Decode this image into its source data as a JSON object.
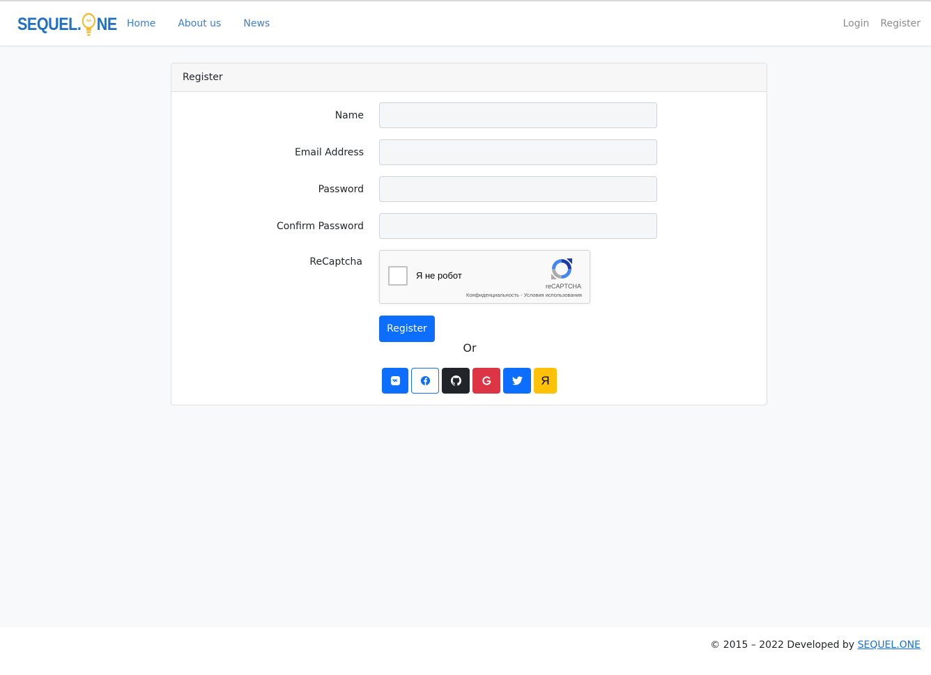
{
  "navbar": {
    "logo": {
      "part1": "SEQUEL.",
      "part2": "NE"
    },
    "links": [
      "Home",
      "About us",
      "News"
    ],
    "auth": {
      "login": "Login",
      "register": "Register"
    }
  },
  "card": {
    "header": "Register",
    "fields": [
      {
        "label": "Name",
        "value": ""
      },
      {
        "label": "Email Address",
        "value": ""
      },
      {
        "label": "Password",
        "value": ""
      },
      {
        "label": "Confirm Password",
        "value": ""
      }
    ],
    "captcha": {
      "label": "ReCaptcha",
      "checkbox_text": "Я не робот",
      "brand": "reCAPTCHA",
      "links": "Конфиденциальность - Условия использования"
    },
    "submit_label": "Register",
    "or_text": "Or",
    "socials": [
      {
        "name": "vk",
        "color": "#0d6efd"
      },
      {
        "name": "facebook",
        "color": "#ffffff"
      },
      {
        "name": "github",
        "color": "#212529"
      },
      {
        "name": "google",
        "color": "#dc3545"
      },
      {
        "name": "twitter",
        "color": "#0d6efd"
      },
      {
        "name": "yandex",
        "label": "Я",
        "color": "#ffc107"
      }
    ]
  },
  "footer": {
    "text": "© 2015 – 2022 Developed by",
    "link": "SEQUEL.ONE"
  },
  "colors": {
    "accent": "#0d6efd",
    "nav_link": "#3b7dd8",
    "logo": "#1f6fc2",
    "logo_bulb": "#f5b82e",
    "background": "#f8f9fa"
  }
}
